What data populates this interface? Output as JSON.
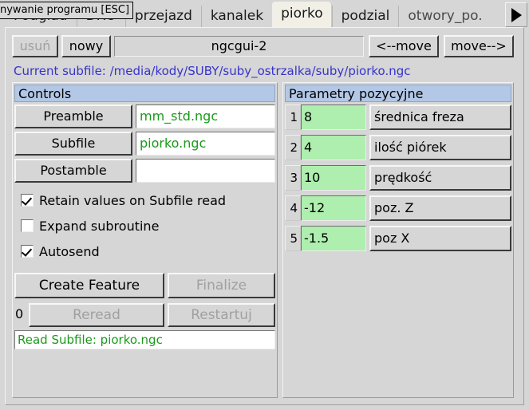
{
  "tabbar": {
    "tooltip": "nywanie programu [ESC]",
    "tabs": [
      {
        "label": "Podglad",
        "active": false
      },
      {
        "label": "DRO",
        "active": false
      },
      {
        "label": "przejazd",
        "active": false
      },
      {
        "label": "kanalek",
        "active": false
      },
      {
        "label": "piorko",
        "active": true
      },
      {
        "label": "podzial",
        "active": false
      },
      {
        "label": "otwory_po.",
        "active": false
      }
    ],
    "scroll_right_icon": "triangle-right-icon"
  },
  "toolbar": {
    "delete_label": "usuń",
    "new_label": "nowy",
    "tab_name": "ngcgui-2",
    "move_left_label": "<--move",
    "move_right_label": "move-->"
  },
  "subfile_line": "Current subfile: /media/kody/SUBY/suby_ostrzalka/suby/piorko.ngc",
  "controls": {
    "title": "Controls",
    "rows": [
      {
        "button": "Preamble",
        "value": "mm_std.ngc"
      },
      {
        "button": "Subfile",
        "value": "piorko.ngc"
      },
      {
        "button": "Postamble",
        "value": ""
      }
    ],
    "checkboxes": [
      {
        "label": "Retain values on Subfile read",
        "checked": true
      },
      {
        "label": "Expand subroutine",
        "checked": false
      },
      {
        "label": "Autosend",
        "checked": true
      }
    ],
    "create_feature_label": "Create Feature",
    "finalize_label": "Finalize",
    "count": "0",
    "reread_label": "Reread",
    "restart_label": "Restartuj",
    "status": "Read Subfile: piorko.ngc"
  },
  "parameters": {
    "title": "Parametry pozycyjne",
    "rows": [
      {
        "num": "1",
        "value": "8",
        "desc": "średnica freza"
      },
      {
        "num": "2",
        "value": "4",
        "desc": "ilość piórek"
      },
      {
        "num": "3",
        "value": "10",
        "desc": "prędkość"
      },
      {
        "num": "4",
        "value": "-12",
        "desc": "poz. Z"
      },
      {
        "num": "5",
        "value": "-1.5",
        "desc": "poz X"
      }
    ]
  },
  "colors": {
    "header_blue": "#b3c7e6",
    "entry_green_text": "#1a9a1a",
    "param_field_green": "#aeeeae",
    "link_blue": "#3733cc",
    "active_tab": "#f2efe6"
  }
}
